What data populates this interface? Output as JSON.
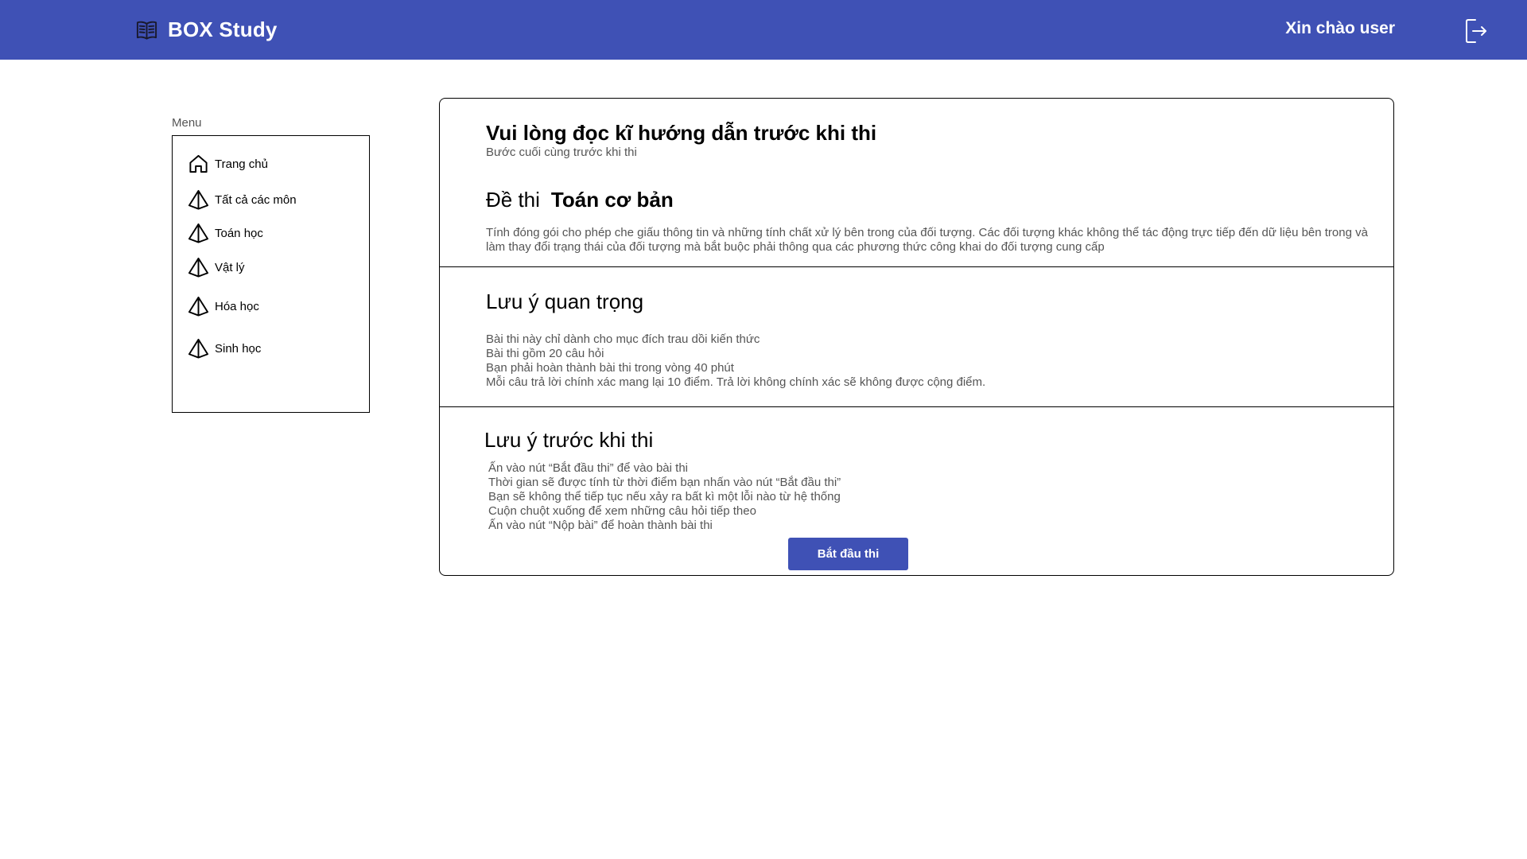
{
  "header": {
    "brand_icon": "open-book-icon",
    "brand_title": "BOX Study",
    "greeting": "Xin chào user",
    "logout_icon": "logout-icon",
    "background_color": "#3f51b5"
  },
  "sidebar": {
    "label": "Menu",
    "items": [
      {
        "icon": "home-icon",
        "label": "Trang chủ"
      },
      {
        "icon": "pyramid-icon",
        "label": "Tất cả các môn"
      },
      {
        "icon": "pyramid-icon",
        "label": "Toán học"
      },
      {
        "icon": "pyramid-icon",
        "label": "Vật lý"
      },
      {
        "icon": "pyramid-icon",
        "label": "Hóa học"
      },
      {
        "icon": "pyramid-icon",
        "label": "Sinh học"
      }
    ]
  },
  "main": {
    "intro": {
      "title": "Vui lòng đọc kĩ hướng dẫn trước khi thi",
      "subtitle": "Bước cuối cùng trước khi thi"
    },
    "exam": {
      "label": "Đề thi",
      "name": "Toán cơ bản",
      "description": "Tính đóng gói cho phép che giấu thông tin và những tính chất xử lý bên trong của đối tượng. Các đối tượng khác không thể tác động trực tiếp đến dữ liệu bên trong và làm thay đổi trạng thái của đối tượng mà bắt buộc phải thông qua các phương thức công khai do đối tượng cung cấp"
    },
    "important": {
      "title": "Lưu ý quan trọng",
      "lines": [
        "Bài thi này chỉ dành cho mục đích trau dồi kiến thức",
        "Bài thi gồm 20 câu hỏi",
        "Bạn phải hoàn thành bài thi trong vòng 40 phút",
        "Mỗi câu trả lời chính xác mang lại 10 điểm. Trả lời không chính xác sẽ không được cộng điểm."
      ]
    },
    "before": {
      "title": "Lưu ý trước khi thi",
      "lines": [
        "Ấn vào nút “Bắt đầu thi” để vào bài thi",
        "Thời gian sẽ được tính từ thời điểm bạn nhấn vào nút “Bắt đầu thi”",
        "Bạn sẽ không thể tiếp tục nếu xảy ra bất kì một lỗi nào từ hệ thống",
        "Cuộn chuột xuống để xem những câu hỏi tiếp theo",
        "Ấn vào nút “Nộp bài” để hoàn thành bài thi"
      ]
    },
    "start_button": "Bắt đầu thi"
  }
}
